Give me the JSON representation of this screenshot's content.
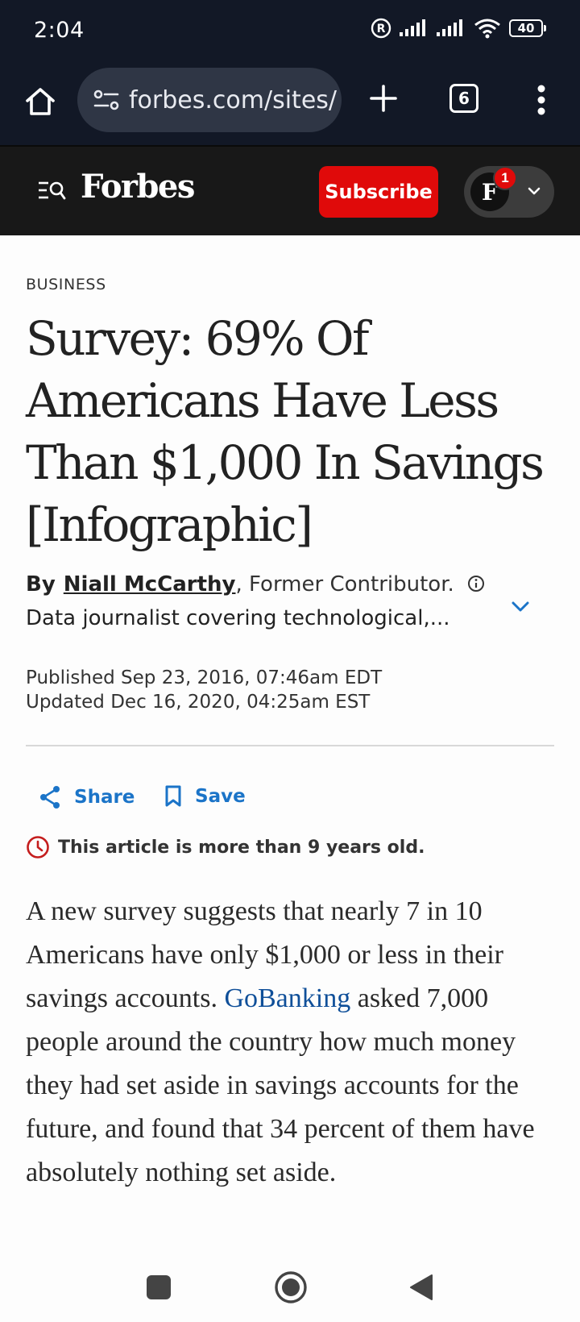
{
  "status_bar": {
    "time": "2:04",
    "battery": "40"
  },
  "browser": {
    "url": "forbes.com/sites/",
    "tab_count": "6"
  },
  "header": {
    "logo": "Forbes",
    "subscribe_label": "Subscribe",
    "avatar_initial": "F",
    "notification_count": "1"
  },
  "article": {
    "section": "BUSINESS",
    "headline": "Survey: 69% Of Americans Have Less Than $1,000 In Savings [Infographic]",
    "by_label": "By",
    "author": "Niall McCarthy",
    "author_role": ", Former Contributor.",
    "bio": "Data journalist covering technological,...",
    "published": "Published Sep 23, 2016, 07:46am EDT",
    "updated": "Updated Dec 16, 2020, 04:25am EST",
    "share_label": "Share",
    "save_label": "Save",
    "age_notice": "This article is more than 9 years old.",
    "body_before_link": "A new survey suggests that nearly 7 in 10 Americans have only $1,000 or less in their savings accounts. ",
    "body_link": "GoBanking",
    "body_after_link": " asked 7,000 people around the country how much money they had set aside in savings accounts for the future, and found that 34 percent of them have absolutely nothing set aside."
  },
  "colors": {
    "accent_red": "#e00a0a",
    "link_blue": "#1b74c8",
    "chrome_dark": "#121826"
  }
}
